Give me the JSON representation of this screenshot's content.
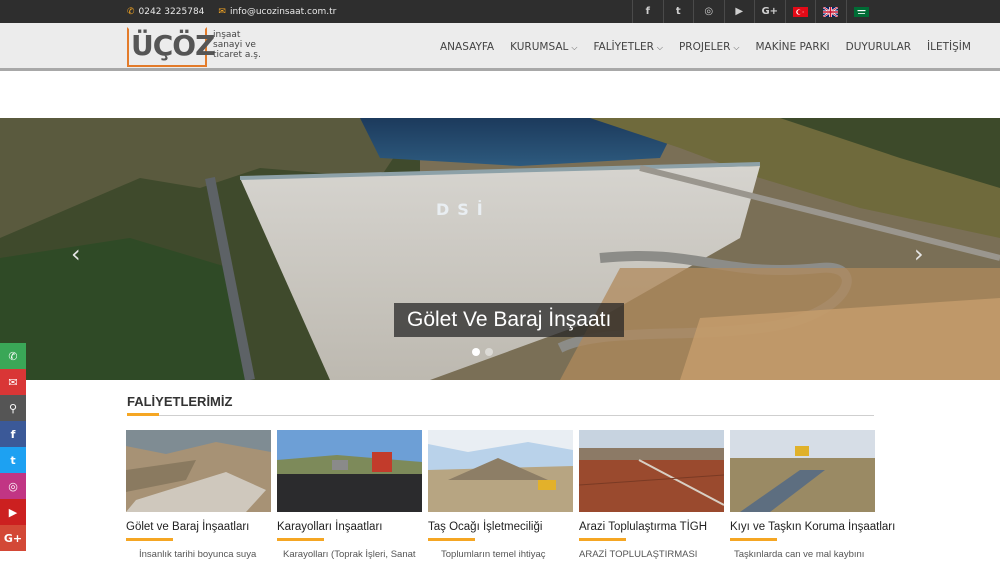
{
  "topbar": {
    "phone": "0242 3225784",
    "email": "info@ucozinsaat.com.tr",
    "social": [
      {
        "icon": "facebook-icon",
        "glyph": "f"
      },
      {
        "icon": "twitter-icon",
        "glyph": "t"
      },
      {
        "icon": "instagram-icon",
        "glyph": "◎"
      },
      {
        "icon": "youtube-icon",
        "glyph": "▶"
      },
      {
        "icon": "google-plus-icon",
        "glyph": "G+"
      }
    ],
    "languages": [
      "tr-flag-icon",
      "en-flag-icon",
      "sa-flag-icon"
    ]
  },
  "logo": {
    "word": "ÜÇÖZ",
    "tagline_1": "inşaat",
    "tagline_2": "sanayi ve",
    "tagline_3": "ticaret a.ş."
  },
  "nav": {
    "items": [
      {
        "label": "ANASAYFA",
        "dropdown": false
      },
      {
        "label": "KURUMSAL",
        "dropdown": true
      },
      {
        "label": "FALİYETLER",
        "dropdown": true
      },
      {
        "label": "PROJELER",
        "dropdown": true
      },
      {
        "label": "MAKİNE PARKI",
        "dropdown": false
      },
      {
        "label": "DUYURULAR",
        "dropdown": false
      },
      {
        "label": "İLETİŞİM",
        "dropdown": false
      }
    ]
  },
  "slider": {
    "caption": "Gölet Ve Baraj İnşaatı",
    "dam_text": "DSİ",
    "dot_count": 2,
    "active_dot": 1
  },
  "side_contacts": [
    {
      "icon": "phone-icon",
      "color": "#3aa757",
      "glyph": "✆"
    },
    {
      "icon": "mail-icon",
      "color": "#d93636",
      "glyph": "✉"
    },
    {
      "icon": "location-icon",
      "color": "#555555",
      "glyph": "⚲"
    },
    {
      "icon": "facebook-icon",
      "color": "#3b5998",
      "glyph": "f"
    },
    {
      "icon": "twitter-icon",
      "color": "#1da1f2",
      "glyph": "t"
    },
    {
      "icon": "instagram-icon",
      "color": "#c13584",
      "glyph": "◎"
    },
    {
      "icon": "youtube-icon",
      "color": "#cc2020",
      "glyph": "▶"
    },
    {
      "icon": "google-plus-icon",
      "color": "#d34836",
      "glyph": "G+"
    }
  ],
  "section": {
    "title": "FALİYETLERİMİZ"
  },
  "activities": [
    {
      "name": "Gölet ve Baraj İnşaatları",
      "desc": "İnsanlık tarihi boyunca suya"
    },
    {
      "name": "Karayolları İnşaatları",
      "desc": "Karayolları (Toprak İşleri, Sanat"
    },
    {
      "name": "Taş Ocağı İşletmeciliği",
      "desc": "Toplumların temel ihtiyaç"
    },
    {
      "name": "Arazi Toplulaştırma TİGH",
      "desc": "ARAZİ TOPLULAŞTIRMASI"
    },
    {
      "name": "Kıyı ve Taşkın Koruma İnşaatları",
      "desc": "Taşkınlarda can ve mal kaybını"
    }
  ],
  "colors": {
    "accent": "#f5a623",
    "topbar": "#2e2e2e",
    "header": "#ececec"
  }
}
